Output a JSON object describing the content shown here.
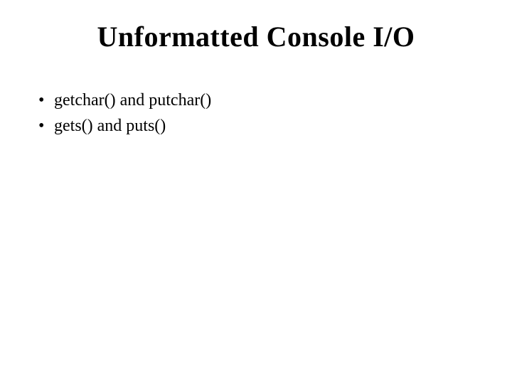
{
  "slide": {
    "title": "Unformatted Console I/O",
    "bullets": [
      "getchar() and putchar()",
      "gets() and puts()"
    ]
  }
}
